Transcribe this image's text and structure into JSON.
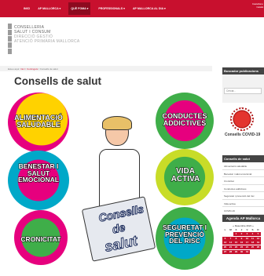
{
  "nav": {
    "items": [
      "INICI",
      "AP MALLORCA ▾",
      "QUÈ FOMA ▾",
      "PROFESSIONALS ▾",
      "AP MALLORCA AL DIA ▾"
    ],
    "active_index": 2,
    "utility": [
      "Castellano",
      "Català"
    ]
  },
  "logo": {
    "lines": [
      "CONSELLERIA",
      "SALUT I CONSUM",
      "DIRECCIÓ GESTIÓ",
      "ATENCIÓ PRIMÀRIA MALLORCA"
    ]
  },
  "breadcrumb": {
    "prefix": "Esteu aquí:",
    "items": [
      "Inici",
      "Continguts",
      "Consells de salut"
    ]
  },
  "page": {
    "title": "Consells de salut"
  },
  "illustration": {
    "tiles": [
      "ALIMENTACIÓ SALUDABLE",
      "BENESTAR I SALUT EMOCIONAL",
      "CRONICITAT",
      "CONDUCTES ADDICTIVES",
      "VIDA ACTIVA",
      "SEGURETAT I PREVENCIÓ DEL RISC"
    ],
    "sign": [
      "Consells",
      "de",
      "salut"
    ]
  },
  "sidebar": {
    "search": {
      "title": "Buscador publicacions",
      "placeholder": "Cercar..."
    },
    "covid": {
      "caption": "Consells COVID-19"
    },
    "menu": {
      "title": "Consells de salut",
      "items": [
        "Alimentació saludable",
        "Benestar i salut emocional",
        "Cronicitat",
        "Conductes addictives",
        "Seguretat i prevenció del risc",
        "Vida activa",
        "COVID-19"
      ]
    },
    "calendar": {
      "title": "Agenda AP Mallorca",
      "month": "Desembre 2021",
      "weekdays": [
        "L",
        "M",
        "X",
        "J",
        "V",
        "S",
        "D"
      ],
      "weeks": [
        [
          "",
          "",
          "1",
          "2",
          "3",
          "4",
          "5"
        ],
        [
          "6",
          "7",
          "8",
          "9",
          "10",
          "11",
          "12"
        ],
        [
          "13",
          "14",
          "15",
          "16",
          "17",
          "18",
          "19"
        ],
        [
          "20",
          "21",
          "22",
          "23",
          "24",
          "25",
          "26"
        ],
        [
          "27",
          "28",
          "29",
          "30",
          "31",
          "",
          ""
        ]
      ]
    }
  },
  "colors": {
    "brand_red": "#c8102e",
    "tile_pink": "#e6007e",
    "tile_yellow": "#ffd200",
    "tile_cyan": "#00a8c8",
    "tile_green": "#3fae49",
    "tile_lime": "#c8dc28"
  }
}
